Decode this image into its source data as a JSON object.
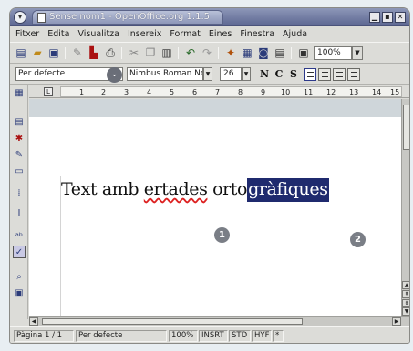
{
  "window": {
    "title": "Sense nom1 - OpenOffice.org 1.1.5"
  },
  "menubar": {
    "items": [
      "Fitxer",
      "Edita",
      "Visualitza",
      "Insereix",
      "Format",
      "Eines",
      "Finestra",
      "Ajuda"
    ]
  },
  "toolbar": {
    "zoom": "100%"
  },
  "formatbar": {
    "paragraph_style": "Per defecte",
    "font_name": "Nimbus Roman No",
    "font_size": "26",
    "bold_label": "N",
    "italic_label": "C",
    "underline_label": "S"
  },
  "ruler": {
    "tick_labels": [
      "1",
      "2",
      "3",
      "4",
      "5",
      "6",
      "7",
      "8",
      "9",
      "10",
      "11",
      "12",
      "13",
      "14",
      "15"
    ]
  },
  "document": {
    "text_before": "Text amb ",
    "misspelled_word": "ertades",
    "text_middle": " orto",
    "selected_text": "gràfiques"
  },
  "markers": [
    "1",
    "2"
  ],
  "statusbar": {
    "page": "Pàgina  1 / 1",
    "style": "Per defecte",
    "zoom": "100%",
    "insert_mode": "INSRT",
    "selection_mode": "STD",
    "hyperlink_mode": "HYF",
    "modified": "*"
  },
  "colors": {
    "selection": "#1f2a6e",
    "titlebar": "#6b75a0",
    "spellcheck": "#d22222"
  }
}
